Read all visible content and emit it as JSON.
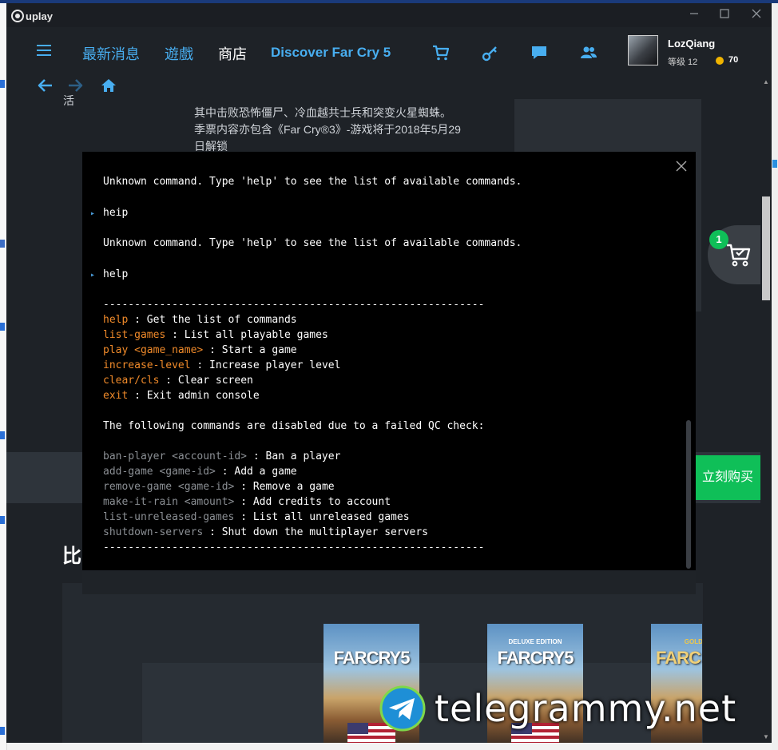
{
  "window": {
    "brand": "uplay",
    "controls": [
      "minimize",
      "maximize",
      "close"
    ]
  },
  "nav": {
    "tabs": [
      {
        "label": "最新消息",
        "active": false
      },
      {
        "label": "遊戲",
        "active": false
      },
      {
        "label": "商店",
        "active": true
      },
      {
        "label": "Discover Far Cry 5",
        "active": false
      }
    ],
    "icons": [
      "cart-icon",
      "key-icon",
      "chat-icon",
      "friends-icon"
    ]
  },
  "user": {
    "name": "LozQiang",
    "level_label": "等级 12",
    "credits": "70"
  },
  "description": {
    "side_char": "活",
    "lines": [
      "其中击败恐怖僵尸、冷血越共士兵和突变火星蜘蛛。",
      "季票内容亦包含《Far Cry®3》-游戏将于2018年5月29",
      "日解锁"
    ]
  },
  "store": {
    "buy_label": "立刻购买",
    "compare_title": "比",
    "cart_count": "1",
    "covers": [
      {
        "title": "FARCRY5",
        "edition": ""
      },
      {
        "title": "FARCRY5",
        "edition": "DELUXE EDITION"
      },
      {
        "title": "FARC",
        "edition": "GOLD ED"
      }
    ]
  },
  "console": {
    "error_line": "Unknown command. Type 'help' to see the list of available commands.",
    "input_1": "heip",
    "input_2": "help",
    "separator": "-------------------------------------------------------------",
    "commands": [
      {
        "name": "help",
        "desc": " : Get the list of commands"
      },
      {
        "name": "list-games",
        "desc": " : List all playable games"
      },
      {
        "name": "play <game_name>",
        "desc": " : Start a game"
      },
      {
        "name": "increase-level",
        "desc": " : Increase player level"
      },
      {
        "name": "clear/cls",
        "desc": " : Clear screen"
      },
      {
        "name": "exit",
        "desc": " : Exit admin console"
      }
    ],
    "disabled_heading": "The following commands are disabled due to a failed QC check:",
    "disabled_commands": [
      {
        "name": "ban-player <account-id>",
        "desc": " : Ban a player"
      },
      {
        "name": "add-game <game-id>",
        "desc": " : Add a game"
      },
      {
        "name": "remove-game <game-id>",
        "desc": " : Remove a game"
      },
      {
        "name": "make-it-rain <amount>",
        "desc": " : Add credits to account"
      },
      {
        "name": "list-unreleased-games",
        "desc": " : List all unreleased games"
      },
      {
        "name": "shutdown-servers",
        "desc": " : Shut down the multiplayer servers"
      }
    ]
  },
  "watermark": {
    "text": "telegrammy.net"
  },
  "colors": {
    "accent": "#48aef0",
    "command": "#f08a2a",
    "buy_green": "#0fbf58",
    "background": "#1e2227"
  }
}
